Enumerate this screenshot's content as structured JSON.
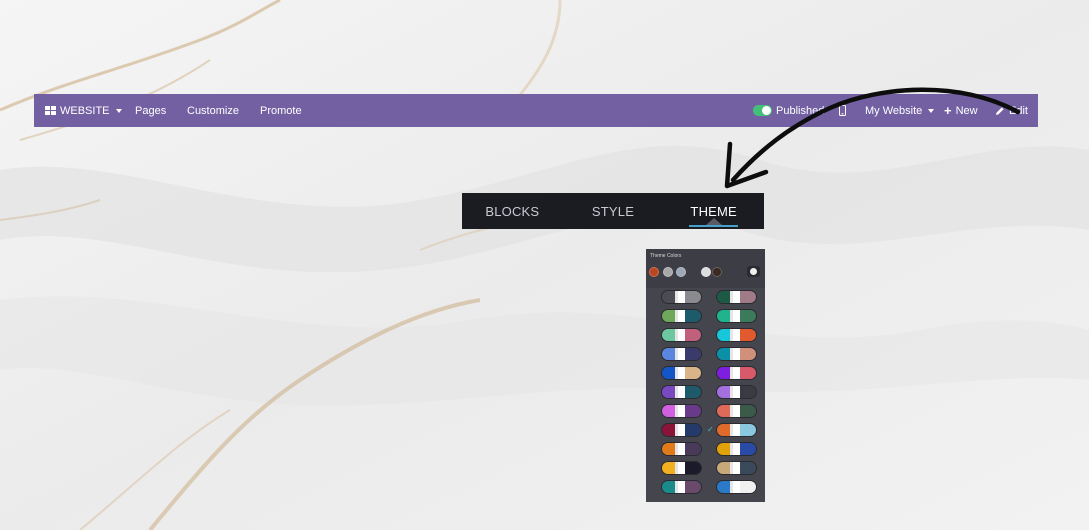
{
  "navbar": {
    "website_label": "WEBSITE",
    "pages_label": "Pages",
    "customize_label": "Customize",
    "promote_label": "Promote",
    "published_label": "Published",
    "site_label": "My Website",
    "new_label": "New",
    "edit_label": "Edit",
    "icons": {
      "app": "apps-grid-icon",
      "published": "toggle-on-icon",
      "mobile": "mobile-icon",
      "new": "plus-icon",
      "edit": "pencil-icon"
    },
    "colors": {
      "bar": "#7260a2",
      "toggle": "#45c07a"
    }
  },
  "editor": {
    "tabs": [
      {
        "label": "BLOCKS",
        "active": false
      },
      {
        "label": "STYLE",
        "active": false
      },
      {
        "label": "THEME",
        "active": true
      }
    ],
    "colors": {
      "bg": "#1b1b22",
      "active_underline": "#45a1c9"
    }
  },
  "theme_colors": {
    "title": "Theme Colors",
    "current_colors": [
      "#b8461f",
      "#a8a8a8",
      "#9ea9b5",
      "#dddddd",
      "#3a2a22"
    ],
    "palettes": [
      {
        "col": 0,
        "row": 0,
        "colors": [
          "#4b4b52",
          "#e6e6e6",
          "#ffffff",
          "#8b8b8f"
        ],
        "selected": false
      },
      {
        "col": 1,
        "row": 0,
        "colors": [
          "#1d5a45",
          "#e6e6e6",
          "#ffffff",
          "#a07a86"
        ],
        "selected": false
      },
      {
        "col": 0,
        "row": 1,
        "colors": [
          "#6fa85a",
          "#e6e6e6",
          "#ffffff",
          "#1d5a6a"
        ],
        "selected": false
      },
      {
        "col": 1,
        "row": 1,
        "colors": [
          "#20b38c",
          "#e6e6e6",
          "#ffffff",
          "#3b7a5a"
        ],
        "selected": false
      },
      {
        "col": 0,
        "row": 2,
        "colors": [
          "#6dc8a0",
          "#e6e6e6",
          "#ffffff",
          "#c0607c"
        ],
        "selected": false
      },
      {
        "col": 1,
        "row": 2,
        "colors": [
          "#17c6d8",
          "#e6e6e6",
          "#ffffff",
          "#e05a2e"
        ],
        "selected": false
      },
      {
        "col": 0,
        "row": 3,
        "colors": [
          "#5a86e0",
          "#e6e6e6",
          "#ffffff",
          "#3b3b6b"
        ],
        "selected": false
      },
      {
        "col": 1,
        "row": 3,
        "colors": [
          "#0c90a8",
          "#e6e6e6",
          "#ffffff",
          "#d0907a"
        ],
        "selected": false
      },
      {
        "col": 0,
        "row": 4,
        "colors": [
          "#1456c8",
          "#e6e6e6",
          "#ffffff",
          "#d8b488"
        ],
        "selected": false
      },
      {
        "col": 1,
        "row": 4,
        "colors": [
          "#7e1fe0",
          "#e6e6e6",
          "#ffffff",
          "#d85a6a"
        ],
        "selected": false
      },
      {
        "col": 0,
        "row": 5,
        "colors": [
          "#7a48c0",
          "#e6e6e6",
          "#ffffff",
          "#1d5a6a"
        ],
        "selected": false
      },
      {
        "col": 1,
        "row": 5,
        "colors": [
          "#a470e0",
          "#e6e6e6",
          "#ffffff",
          "#3a3a44"
        ],
        "selected": false
      },
      {
        "col": 0,
        "row": 6,
        "colors": [
          "#d060e0",
          "#e6e6e6",
          "#ffffff",
          "#6a3a8a"
        ],
        "selected": false
      },
      {
        "col": 1,
        "row": 6,
        "colors": [
          "#e06a5a",
          "#e6e6e6",
          "#ffffff",
          "#3b5a4a"
        ],
        "selected": false
      },
      {
        "col": 0,
        "row": 7,
        "colors": [
          "#8a1438",
          "#e6e6e6",
          "#ffffff",
          "#243a6a"
        ],
        "selected": false
      },
      {
        "col": 1,
        "row": 7,
        "colors": [
          "#e06a2a",
          "#e6e6e6",
          "#ffffff",
          "#8ac8e0"
        ],
        "selected": true
      },
      {
        "col": 0,
        "row": 8,
        "colors": [
          "#e07a1a",
          "#e6e6e6",
          "#ffffff",
          "#4a3a5a"
        ],
        "selected": false
      },
      {
        "col": 1,
        "row": 8,
        "colors": [
          "#e0a20a",
          "#e6e6e6",
          "#ffffff",
          "#2a4aa8"
        ],
        "selected": false
      },
      {
        "col": 0,
        "row": 9,
        "colors": [
          "#f0b020",
          "#e6e6e6",
          "#ffffff",
          "#1a1a2a"
        ],
        "selected": false
      },
      {
        "col": 1,
        "row": 9,
        "colors": [
          "#c8a878",
          "#e6e6e6",
          "#ffffff",
          "#3a4a5a"
        ],
        "selected": false
      },
      {
        "col": 0,
        "row": 10,
        "colors": [
          "#1a8a8a",
          "#e6e6e6",
          "#ffffff",
          "#6a4a6a"
        ],
        "selected": false
      },
      {
        "col": 1,
        "row": 10,
        "colors": [
          "#2a7ac8",
          "#e6e6e6",
          "#ffffff",
          "#f0f0f0"
        ],
        "selected": false
      }
    ],
    "icons": {
      "palette": "palette-icon",
      "selected": "check-icon"
    }
  },
  "annotation": {
    "arrow": "curved-arrow-icon"
  }
}
